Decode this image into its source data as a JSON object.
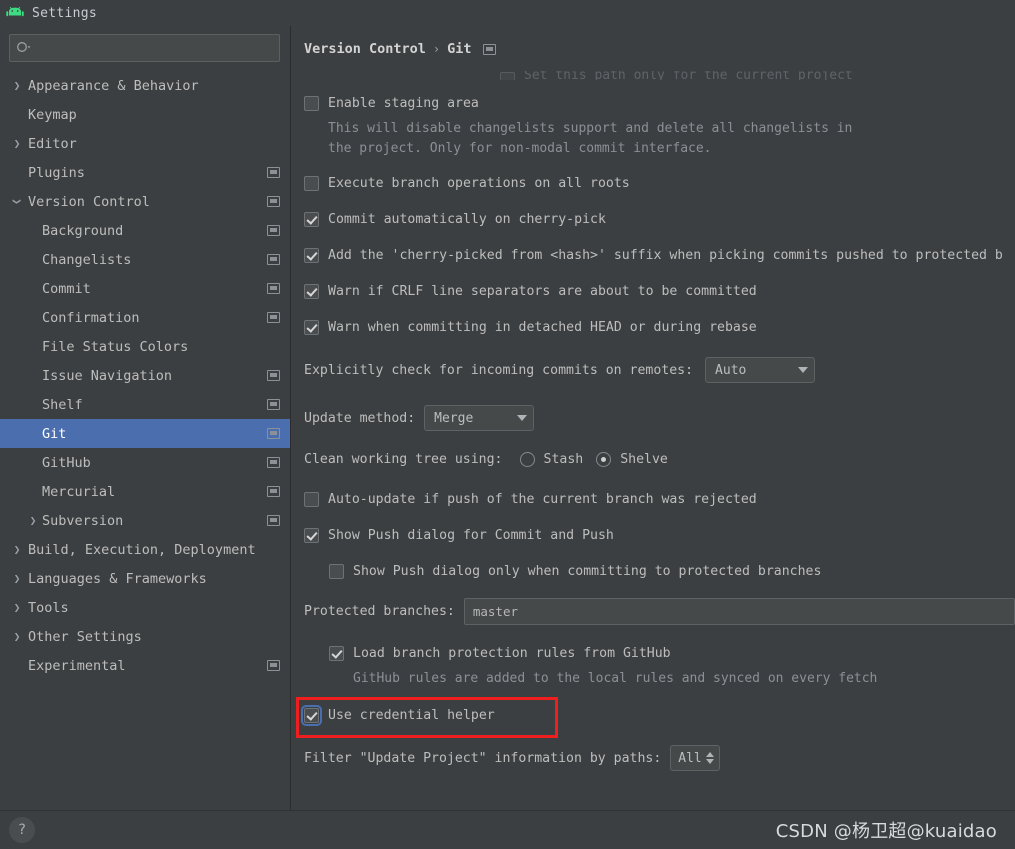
{
  "window": {
    "title": "Settings",
    "app_icon": "android-icon"
  },
  "search": {
    "placeholder": "",
    "value": "",
    "icon": "search-icon"
  },
  "sidebar": {
    "items": [
      {
        "label": "Appearance & Behavior",
        "level": 0,
        "twisty": "collapsed",
        "config_icon": false,
        "selected": false
      },
      {
        "label": "Keymap",
        "level": 0,
        "twisty": "none",
        "config_icon": false,
        "selected": false
      },
      {
        "label": "Editor",
        "level": 0,
        "twisty": "collapsed",
        "config_icon": false,
        "selected": false
      },
      {
        "label": "Plugins",
        "level": 0,
        "twisty": "none",
        "config_icon": true,
        "selected": false
      },
      {
        "label": "Version Control",
        "level": 0,
        "twisty": "expanded",
        "config_icon": true,
        "selected": false
      },
      {
        "label": "Background",
        "level": 1,
        "twisty": "none",
        "config_icon": true,
        "selected": false
      },
      {
        "label": "Changelists",
        "level": 1,
        "twisty": "none",
        "config_icon": true,
        "selected": false
      },
      {
        "label": "Commit",
        "level": 1,
        "twisty": "none",
        "config_icon": true,
        "selected": false
      },
      {
        "label": "Confirmation",
        "level": 1,
        "twisty": "none",
        "config_icon": true,
        "selected": false
      },
      {
        "label": "File Status Colors",
        "level": 1,
        "twisty": "none",
        "config_icon": false,
        "selected": false
      },
      {
        "label": "Issue Navigation",
        "level": 1,
        "twisty": "none",
        "config_icon": true,
        "selected": false
      },
      {
        "label": "Shelf",
        "level": 1,
        "twisty": "none",
        "config_icon": true,
        "selected": false
      },
      {
        "label": "Git",
        "level": 1,
        "twisty": "none",
        "config_icon": true,
        "selected": true
      },
      {
        "label": "GitHub",
        "level": 1,
        "twisty": "none",
        "config_icon": true,
        "selected": false
      },
      {
        "label": "Mercurial",
        "level": 1,
        "twisty": "none",
        "config_icon": true,
        "selected": false
      },
      {
        "label": "Subversion",
        "level": 1,
        "twisty": "collapsed",
        "config_icon": true,
        "selected": false
      },
      {
        "label": "Build, Execution, Deployment",
        "level": 0,
        "twisty": "collapsed",
        "config_icon": false,
        "selected": false
      },
      {
        "label": "Languages & Frameworks",
        "level": 0,
        "twisty": "collapsed",
        "config_icon": false,
        "selected": false
      },
      {
        "label": "Tools",
        "level": 0,
        "twisty": "collapsed",
        "config_icon": false,
        "selected": false
      },
      {
        "label": "Other Settings",
        "level": 0,
        "twisty": "collapsed",
        "config_icon": false,
        "selected": false
      },
      {
        "label": "Experimental",
        "level": 0,
        "twisty": "none",
        "config_icon": true,
        "selected": false
      }
    ]
  },
  "breadcrumb": {
    "parent": "Version Control",
    "separator": "›",
    "current": "Git",
    "config_icon": "project-settings-icon"
  },
  "main": {
    "cutoff_row": {
      "label": "Set this path only for the current project",
      "checked": false
    },
    "enable_staging": {
      "label": "Enable staging area",
      "checked": false,
      "hint_line1": "This will disable changelists support and delete all changelists in",
      "hint_line2": "the project. Only for non-modal commit interface."
    },
    "execute_branch_ops": {
      "label": "Execute branch operations on all roots",
      "checked": false
    },
    "commit_auto_cherry_pick": {
      "label": "Commit automatically on cherry-pick",
      "checked": true
    },
    "add_cherry_picked_suffix": {
      "label": "Add the 'cherry-picked from <hash>' suffix when picking commits pushed to protected b",
      "checked": true
    },
    "warn_crlf": {
      "label": "Warn if CRLF line separators are about to be committed",
      "checked": true
    },
    "warn_detached_head": {
      "label": "Warn when committing in detached HEAD or during rebase",
      "checked": true
    },
    "incoming_commits": {
      "label": "Explicitly check for incoming commits on remotes:",
      "value": "Auto"
    },
    "update_method": {
      "label": "Update method:",
      "value": "Merge"
    },
    "clean_working_tree": {
      "label": "Clean working tree using:",
      "option_stash": "Stash",
      "option_shelve": "Shelve",
      "selected": "Shelve"
    },
    "auto_update_push_rejected": {
      "label": "Auto-update if push of the current branch was rejected",
      "checked": false
    },
    "show_push_dialog": {
      "label": "Show Push dialog for Commit and Push",
      "checked": true
    },
    "show_push_dialog_protected": {
      "label": "Show Push dialog only when committing to protected branches",
      "checked": false
    },
    "protected_branches": {
      "label": "Protected branches:",
      "value": "master",
      "placeholder": ""
    },
    "load_branch_protection": {
      "label": "Load branch protection rules from GitHub",
      "checked": true,
      "hint": "GitHub rules are added to the local rules and synced on every fetch"
    },
    "use_credential_helper": {
      "label": "Use credential helper",
      "checked": true,
      "highlighted": true
    },
    "filter_update_project": {
      "label": "Filter \"Update Project\" information by paths:",
      "value": "All"
    }
  },
  "bottom": {
    "help_label": "?",
    "watermark": "CSDN @杨卫超@kuaidao"
  },
  "colors": {
    "background": "#3c3f41",
    "selection": "#4b6eaf",
    "highlight_red": "#f01f1f",
    "android_green": "#3ddc84"
  }
}
